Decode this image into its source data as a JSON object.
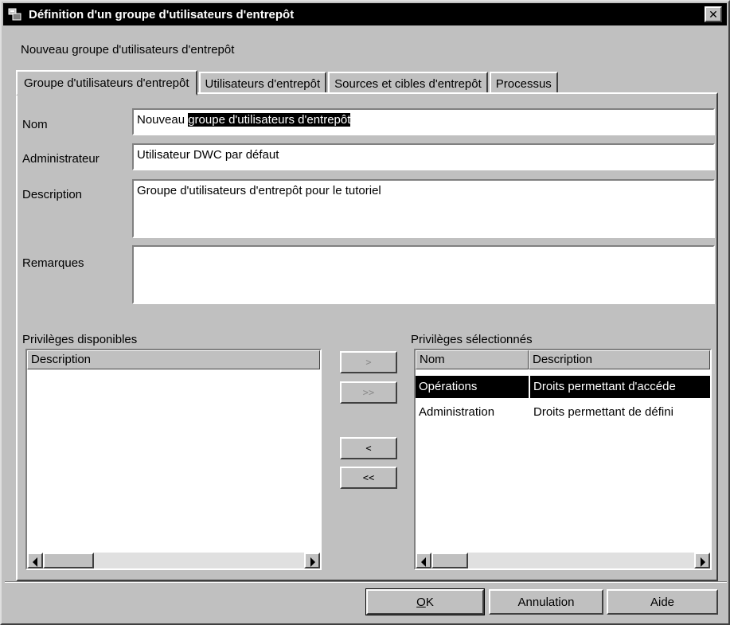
{
  "window": {
    "title": "Définition d'un groupe d'utilisateurs d'entrepôt",
    "close_glyph": "✕",
    "subtitle": "Nouveau groupe d'utilisateurs d'entrepôt"
  },
  "tabs": [
    {
      "label": "Groupe d'utilisateurs d'entrepôt",
      "active": true
    },
    {
      "label": "Utilisateurs d'entrepôt"
    },
    {
      "label": "Sources et cibles d'entrepôt"
    },
    {
      "label": "Processus"
    }
  ],
  "form": {
    "nom_label": "Nom",
    "nom_value_plain": "Nouveau ",
    "nom_value_selected": "groupe d'utilisateurs d'entrepôt",
    "admin_label": "Administrateur",
    "admin_value": "Utilisateur DWC par défaut",
    "description_label": "Description",
    "description_value": "Groupe d'utilisateurs d'entrepôt pour le tutoriel",
    "remarques_label": "Remarques",
    "remarques_value": ""
  },
  "available": {
    "label": "Privilèges disponibles",
    "column": "Description",
    "rows": []
  },
  "move_buttons": {
    "add": ">",
    "add_all": ">>",
    "remove": "<",
    "remove_all": "<<"
  },
  "selected": {
    "label": "Privilèges sélectionnés",
    "columns": [
      "Nom",
      "Description"
    ],
    "rows": [
      {
        "nom": "Opérations",
        "description": "Droits permettant d'accéde",
        "selected": true
      },
      {
        "nom": "Administration",
        "description": "Droits permettant de défini",
        "selected": false
      }
    ]
  },
  "buttons": {
    "ok_mnemonic": "O",
    "ok_rest": "K",
    "cancel": "Annulation",
    "help": "Aide"
  },
  "icons": {
    "window": "window-app-icon",
    "close": "close-icon"
  }
}
